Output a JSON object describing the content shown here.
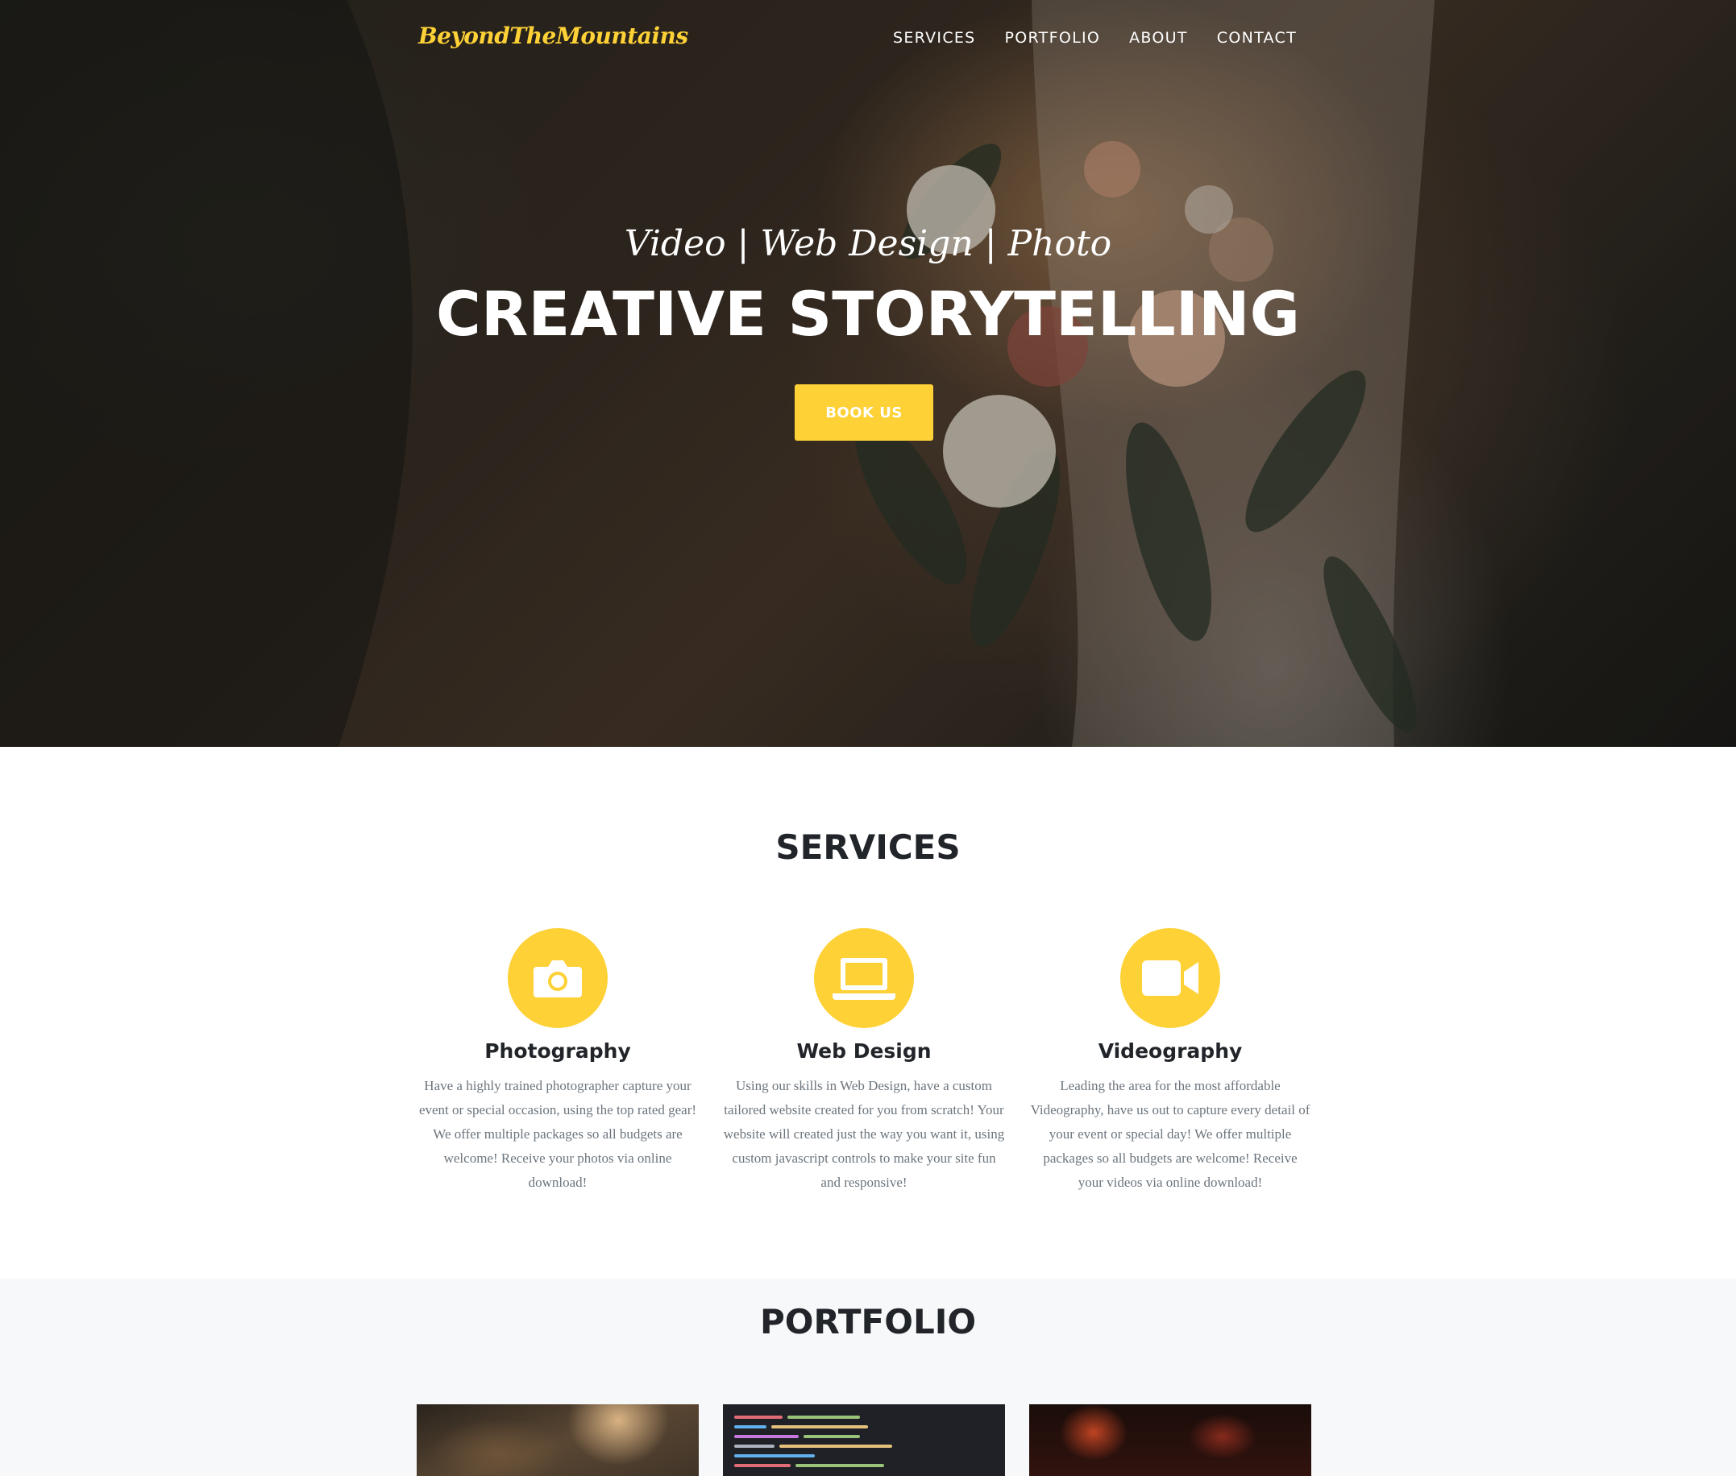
{
  "brand": {
    "logo_text": "BeyondTheMountains"
  },
  "nav": {
    "items": [
      {
        "label": "SERVICES"
      },
      {
        "label": "PORTFOLIO"
      },
      {
        "label": "ABOUT"
      },
      {
        "label": "CONTACT"
      }
    ]
  },
  "hero": {
    "subtitle": "Video | Web Design | Photo",
    "title": "CREATIVE STORYTELLING",
    "cta_label": "BOOK US"
  },
  "services": {
    "heading": "SERVICES",
    "items": [
      {
        "icon": "camera-icon",
        "title": "Photography",
        "description": "Have a highly trained photographer capture your event or special occasion, using the top rated gear! We offer multiple packages so all budgets are welcome! Receive your photos via online download!"
      },
      {
        "icon": "laptop-icon",
        "title": "Web Design",
        "description": "Using our skills in Web Design, have a custom tailored website created for you from scratch! Your website will created just the way you want it, using custom javascript controls to make your site fun and responsive!"
      },
      {
        "icon": "video-camera-icon",
        "title": "Videography",
        "description": "Leading the area for the most affordable Videography, have us out to capture every detail of your event or special day! We offer multiple packages so all budgets are welcome! Receive your videos via online download!"
      }
    ]
  },
  "portfolio": {
    "heading": "PORTFOLIO",
    "thumbnails": [
      {
        "subject": "wedding-photo"
      },
      {
        "subject": "code-editor"
      },
      {
        "subject": "concert-stage"
      }
    ]
  },
  "colors": {
    "accent": "#fed136",
    "heading_text": "#212529",
    "body_text": "#6c757d",
    "portfolio_bg": "#f7f8f9"
  }
}
